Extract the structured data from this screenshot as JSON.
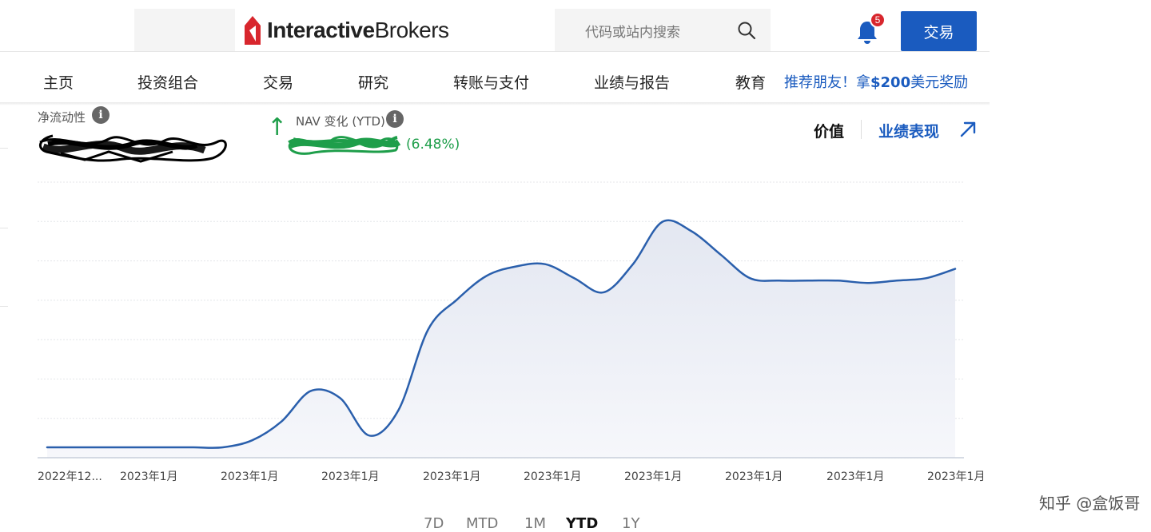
{
  "header": {
    "logo_text_bold": "Interactive",
    "logo_text_regular": "Brokers",
    "search_placeholder": "代码或站内搜索",
    "notification_count": "5",
    "trade_button": "交易"
  },
  "nav": {
    "items": [
      "主页",
      "投资组合",
      "交易",
      "研究",
      "转账与支付",
      "业绩与报告",
      "教育"
    ],
    "promo_text_1": "推荐朋友！拿",
    "promo_text_2": "$200",
    "promo_text_3": "美元奖励"
  },
  "summary": {
    "net_liquidity_label": "净流动性",
    "nav_change_label": "NAV 变化 (YTD)",
    "nav_change_pct": "(6.48%)",
    "view_value": "价值",
    "view_performance": "业绩表现"
  },
  "colors": {
    "accent": "#1a5bbf",
    "positive": "#1e9e4a",
    "line": "#2a5fac",
    "badge": "#d8262d"
  },
  "chart_data": {
    "type": "area",
    "x_ticks": [
      "2022年12...",
      "2023年1月",
      "2023年1月",
      "2023年1月",
      "2023年1月",
      "2023年1月",
      "2023年1月",
      "2023年1月",
      "2023年1月",
      "2023年1月"
    ],
    "series": [
      {
        "values": [
          0.0,
          0.0,
          0.0,
          0.0,
          0.0,
          0.0,
          0.0,
          0.03,
          0.11,
          0.24,
          0.21,
          0.05,
          0.16,
          0.5,
          0.63,
          0.73,
          0.77,
          0.78,
          0.72,
          0.66,
          0.78,
          0.96,
          0.92,
          0.82,
          0.72,
          0.71,
          0.71,
          0.71,
          0.7,
          0.71,
          0.72,
          0.76
        ]
      }
    ],
    "y_axis_labels": "none",
    "grid": true,
    "legend": "none"
  },
  "range_buttons": [
    "7D",
    "MTD",
    "1M",
    "YTD",
    "1Y"
  ],
  "range_active": "YTD",
  "watermark": "知乎 @盒饭哥"
}
